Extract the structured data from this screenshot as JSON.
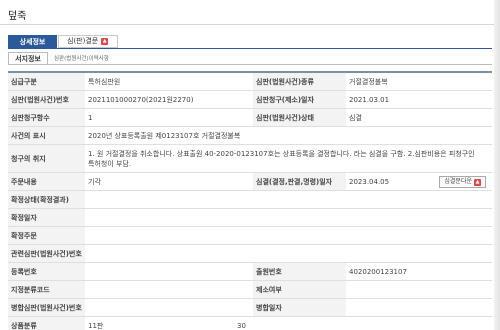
{
  "title": "덮죽",
  "tabs": [
    {
      "label": "상세정보"
    },
    {
      "label": "심(판)결문",
      "icon": "pdf-icon"
    }
  ],
  "subtabs": {
    "active": "서지정보",
    "other": "심판(법원사건)이력사항"
  },
  "rows": {
    "r1": {
      "l1": "심급구분",
      "v1": "특허심판원",
      "l2": "심판(법원사건)종류",
      "v2": "거절결정불복"
    },
    "r2": {
      "l1": "심판(법원사건)번호",
      "v1": "2021101000270(2021원2270)",
      "l2": "심판청구(제소)일자",
      "v2": "2021.03.01"
    },
    "r3": {
      "l1": "심판청구항수",
      "v1": "1",
      "l2": "심판(법원사건)상태",
      "v2": "심결"
    },
    "r4": {
      "l1": "사건의 표시",
      "v1": "2020년 상표등록출원 제0123107호 거절결정불복"
    },
    "r5": {
      "l1": "청구의 취지",
      "v1": "1. 원 거절결정을 취소합니다. 상표출원 40-2020-0123107호는 상표등록을 결정합니다. 라는 심결을 구함. 2.심판비용은 피청구인 특허청이 부담."
    },
    "r6": {
      "l1": "주문내용",
      "v1": "기각",
      "l2": "심결(결정,판결,명령)일자",
      "v2": "2023.04.05",
      "button": "심결문다운"
    },
    "r7": {
      "l1": "확정상태(확정결과)"
    },
    "r8": {
      "l1": "확정일자"
    },
    "r9": {
      "l1": "확정주문"
    },
    "r10": {
      "l1": "관련심판(법원사건)번호"
    },
    "r11": {
      "l1": "등록번호",
      "l2": "출원번호",
      "v2": "4020200123107"
    },
    "r12": {
      "l1": "지정분류코드",
      "l2": "제소여부"
    },
    "r13": {
      "l1": "병합심판(법원사건)번호",
      "l2": "병합일자"
    },
    "r14": {
      "l1": "상품분류",
      "v1": "11판",
      "v1b": "30"
    }
  }
}
